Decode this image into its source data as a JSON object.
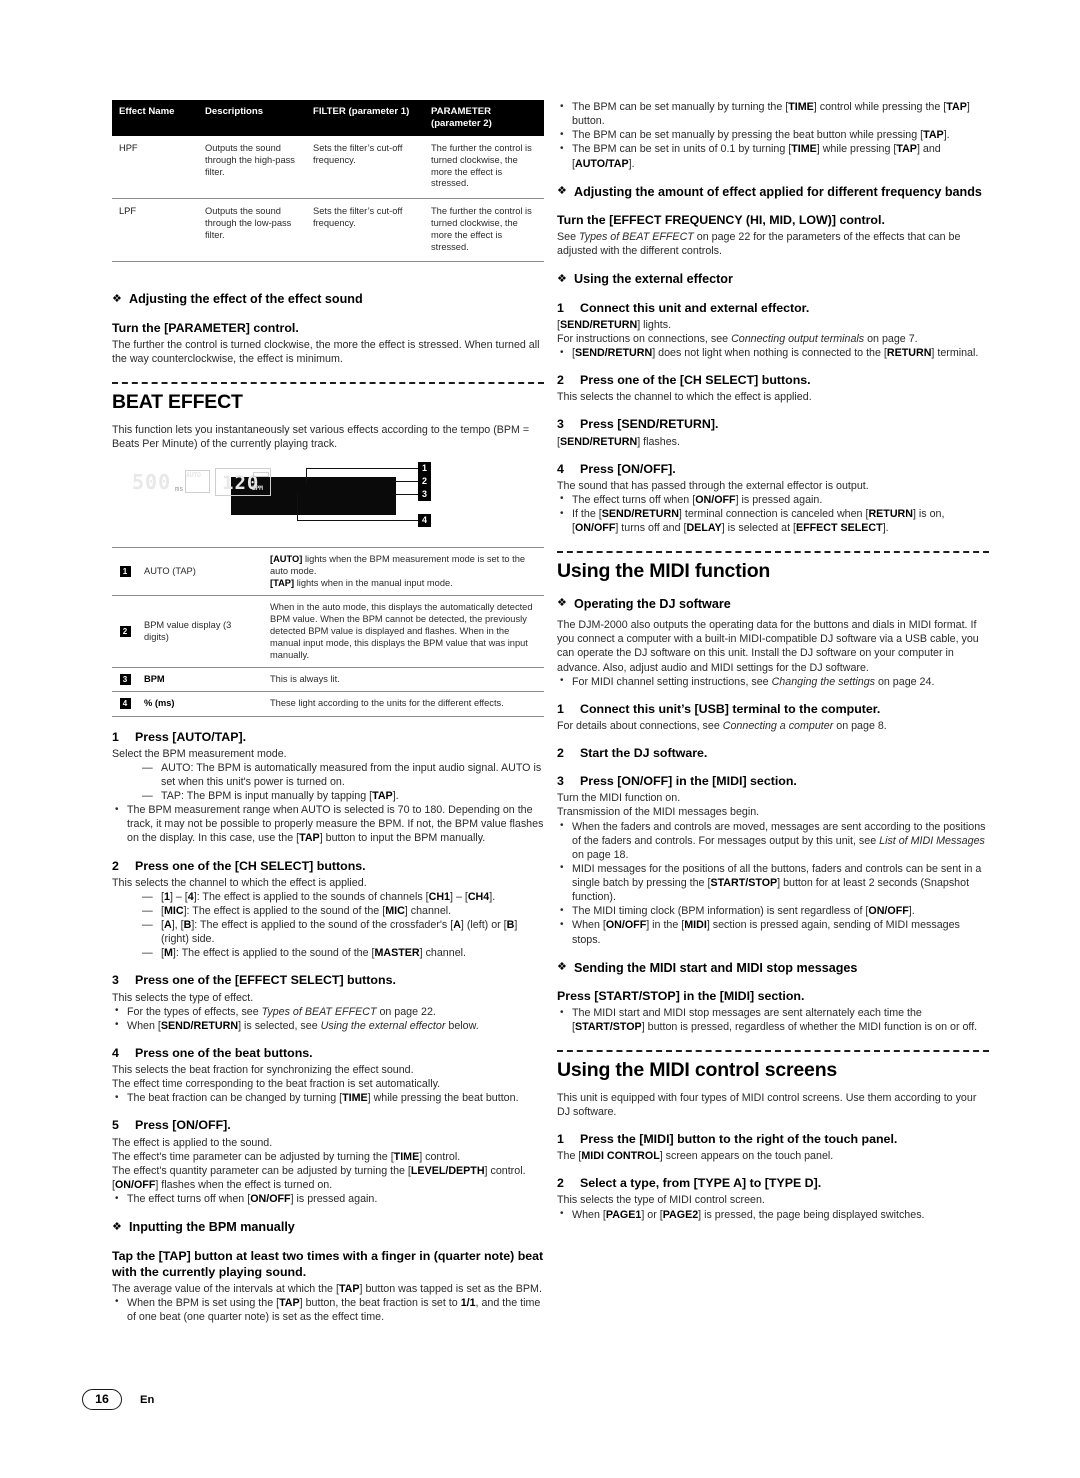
{
  "page": {
    "number": "16",
    "language": "En"
  },
  "effect_table": {
    "headers": [
      "Effect Name",
      "Descriptions",
      "FILTER (parameter 1)",
      "PARAMETER (parameter 2)"
    ],
    "header_parameter_line1": "PARAMETER",
    "header_parameter_line2": "(parameter 2)",
    "rows": [
      {
        "name": "HPF",
        "description": "Outputs the sound through the high-pass filter.",
        "filter": "Sets the filter’s cut-off frequency.",
        "parameter": "The further the control is turned clockwise, the more the effect is stressed."
      },
      {
        "name": "LPF",
        "description": "Outputs the sound through the low-pass filter.",
        "filter": "Sets the filter’s cut-off frequency.",
        "parameter": "The further the control is turned clockwise, the more the effect is stressed."
      }
    ]
  },
  "left": {
    "adjusting_effect_sound": {
      "heading": "Adjusting the effect of the effect sound",
      "subheading": "Turn the [PARAMETER] control.",
      "body": "The further the control is turned clockwise, the more the effect is stressed. When turned all the way counterclockwise, the effect is minimum."
    },
    "beat_effect": {
      "title": "BEAT EFFECT",
      "intro": "This function lets you instantaneously set various effects according to the tempo (BPM = Beats Per Minute) of the currently playing track."
    },
    "display_figure": {
      "value_ms": "500",
      "unit_ms": "ms",
      "label_auto": "AUTO",
      "value_bpm": "120",
      "label_bpm": "BPM",
      "callouts": [
        "1",
        "2",
        "3",
        "4"
      ]
    },
    "legend_table": {
      "rows": [
        {
          "num": "1",
          "label": "AUTO (TAP)",
          "desc_line1_a": "[AUTO]",
          "desc_line1_b": " lights when the BPM measurement mode is set to the auto mode.",
          "desc_line2_a": "[TAP]",
          "desc_line2_b": " lights when in the manual input mode."
        },
        {
          "num": "2",
          "label": "BPM value display (3 digits)",
          "desc": "When in the auto mode, this displays the automatically detected BPM value. When the BPM cannot be detected, the previously detected BPM value is displayed and flashes. When in the manual input mode, this displays the BPM value that was input manually."
        },
        {
          "num": "3",
          "label": "BPM",
          "desc": "This is always lit."
        },
        {
          "num": "4",
          "label": "% (ms)",
          "desc": "These light according to the units for the different effects."
        }
      ]
    },
    "step1": {
      "num": "1",
      "title": "Press [AUTO/TAP].",
      "body": "Select the BPM measurement mode.",
      "dashes": [
        "AUTO: The BPM is automatically measured from the input audio signal. AUTO is set when this unit's power is turned on.",
        "TAP: The BPM is input manually by tapping [TAP]."
      ],
      "bullet": "The BPM measurement range when AUTO is selected is 70 to 180. Depending on the track, it may not be possible to properly measure the BPM. If not, the BPM value flashes on the display. In this case, use the [TAP] button to input the BPM manually."
    },
    "step2": {
      "num": "2",
      "title": "Press one of the [CH SELECT] buttons.",
      "body": "This selects the channel to which the effect is applied.",
      "dashes": [
        "[1] – [4]: The effect is applied to the sounds of channels [CH1] – [CH4].",
        "[MIC]: The effect is applied to the sound of the [MIC] channel.",
        "[A], [B]: The effect is applied to the sound of the crossfader's [A] (left) or [B] (right) side.",
        "[M]: The effect is applied to the sound of the [MASTER] channel."
      ]
    },
    "step3": {
      "num": "3",
      "title": "Press one of the [EFFECT SELECT] buttons.",
      "body": "This selects the type of effect.",
      "bullets": [
        "For the types of effects, see Types of BEAT EFFECT on page 22.",
        "When [SEND/RETURN] is selected, see Using the external effector below."
      ]
    },
    "step4": {
      "num": "4",
      "title": "Press one of the beat buttons.",
      "body1": "This selects the beat fraction for synchronizing the effect sound.",
      "body2": "The effect time corresponding to the beat fraction is set automatically.",
      "bullet": "The beat fraction can be changed by turning [TIME] while pressing the beat button."
    },
    "step5": {
      "num": "5",
      "title": "Press [ON/OFF].",
      "body1": "The effect is applied to the sound.",
      "body2": "The effect's time parameter can be adjusted by turning the [TIME] control.",
      "body3": "The effect's quantity parameter can be adjusted by turning the [LEVEL/DEPTH] control.",
      "body4": "[ON/OFF] flashes when the effect is turned on.",
      "bullet": "The effect turns off when [ON/OFF] is pressed again."
    },
    "bpm_manual": {
      "heading": "Inputting the BPM manually",
      "subheading": "Tap the [TAP] button at least two times with a finger in (quarter note) beat with the currently playing sound.",
      "body": "The average value of the intervals at which the [TAP] button was tapped is set as the BPM.",
      "bullet": "When the BPM is set using the [TAP] button, the beat fraction is set to 1/1, and the time of one beat (one quarter note) is set as the effect time."
    }
  },
  "right": {
    "top_bullets": [
      "The BPM can be set manually by turning the [TIME] control while pressing the [TAP] button.",
      "The BPM can be set manually by pressing the beat button while pressing [TAP].",
      "The BPM can be set in units of 0.1 by turning [TIME] while pressing [TAP] and [AUTO/TAP]."
    ],
    "freq_bands": {
      "heading": "Adjusting the amount of effect applied for different frequency bands",
      "subheading": "Turn the [EFFECT FREQUENCY (HI, MID, LOW)] control.",
      "body": "See Types of BEAT EFFECT on page 22 for the parameters of the effects that can be adjusted with the different controls."
    },
    "external_effector": {
      "heading": "Using the external effector",
      "step1": {
        "num": "1",
        "title": "Connect this unit and external effector.",
        "body1": "[SEND/RETURN] lights.",
        "body2": "For instructions on connections, see Connecting output terminals on page 7.",
        "bullet": "[SEND/RETURN] does not light when nothing is connected to the [RETURN] terminal."
      },
      "step2": {
        "num": "2",
        "title": "Press one of the [CH SELECT] buttons.",
        "body": "This selects the channel to which the effect is applied."
      },
      "step3": {
        "num": "3",
        "title": "Press [SEND/RETURN].",
        "body": "[SEND/RETURN] flashes."
      },
      "step4": {
        "num": "4",
        "title": "Press [ON/OFF].",
        "body": "The sound that has passed through the external effector is output.",
        "bullets": [
          "The effect turns off when [ON/OFF] is pressed again.",
          "If the [SEND/RETURN] terminal connection is canceled when [RETURN] is on, [ON/OFF] turns off and [DELAY] is selected at [EFFECT SELECT]."
        ]
      }
    },
    "midi_function": {
      "title": "Using the MIDI function",
      "dj_software": {
        "heading": "Operating the DJ software",
        "body": "The DJM-2000 also outputs the operating data for the buttons and dials in MIDI format. If you connect a computer with a built-in MIDI-compatible DJ software via a USB cable, you can operate the DJ software on this unit. Install the DJ software on your computer in advance. Also, adjust audio and MIDI settings for the DJ software.",
        "bullet": "For MIDI channel setting instructions, see Changing the settings on page 24."
      },
      "step1": {
        "num": "1",
        "title": "Connect this unit’s [USB] terminal to the computer.",
        "body": "For details about connections, see Connecting a computer on page 8."
      },
      "step2": {
        "num": "2",
        "title": "Start the DJ software."
      },
      "step3": {
        "num": "3",
        "title": "Press [ON/OFF] in the [MIDI] section.",
        "body1": "Turn the MIDI function on.",
        "body2": "Transmission of the MIDI messages begin.",
        "bullets": [
          "When the faders and controls are moved, messages are sent according to the positions of the faders and controls. For messages output by this unit, see List of MIDI Messages on page 18.",
          "MIDI messages for the positions of all the buttons, faders and controls can be sent in a single batch by pressing the [START/STOP] button for at least 2 seconds (Snapshot function).",
          "The MIDI timing clock (BPM information) is sent regardless of [ON/OFF].",
          "When [ON/OFF] in the [MIDI] section is pressed again, sending of MIDI messages stops."
        ]
      },
      "midi_start_stop": {
        "heading": "Sending the MIDI start and MIDI stop messages",
        "subheading": "Press [START/STOP] in the [MIDI] section.",
        "bullet": "The MIDI start and MIDI stop messages are sent alternately each time the [START/STOP] button is pressed, regardless of whether the MIDI function is on or off."
      }
    },
    "midi_control_screens": {
      "title": "Using the MIDI control screens",
      "body": "This unit is equipped with four types of MIDI control screens. Use them according to your DJ software.",
      "step1": {
        "num": "1",
        "title": "Press the [MIDI] button to the right of the touch panel.",
        "body": "The [MIDI CONTROL] screen appears on the touch panel."
      },
      "step2": {
        "num": "2",
        "title": "Select a type, from [TYPE A] to [TYPE D].",
        "body": "This selects the type of MIDI control screen.",
        "bullet": "When [PAGE1] or [PAGE2] is pressed, the page being displayed switches."
      }
    }
  }
}
